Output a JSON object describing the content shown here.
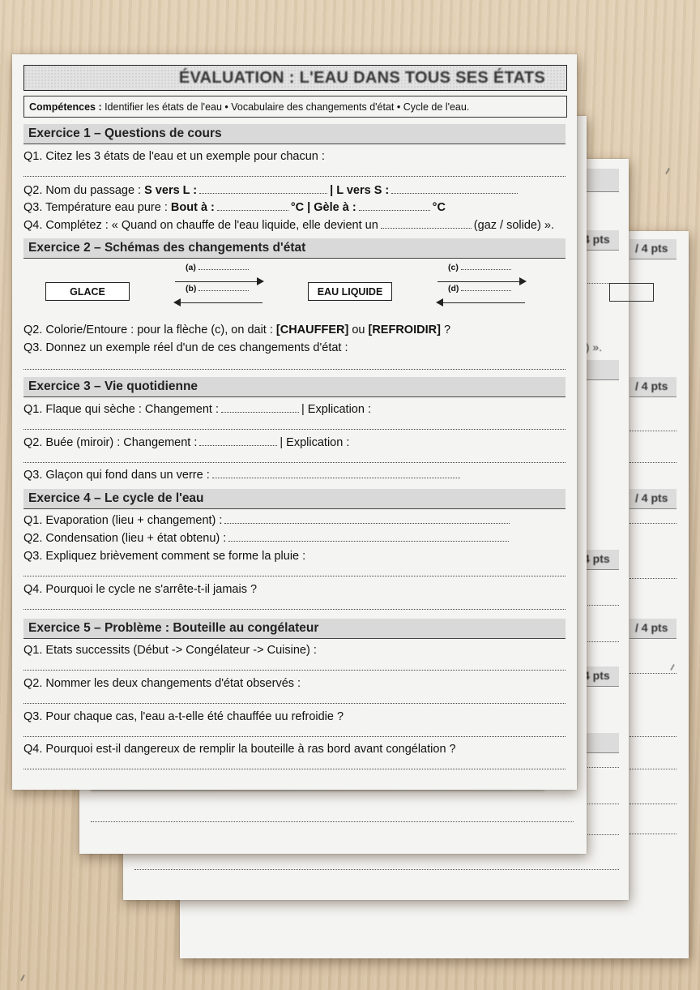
{
  "worksheet": {
    "title": "ÉVALUATION : L'EAU DANS TOUS SES ÉTATS",
    "competences_label": "Compétences :",
    "competences_text": " Identifier les états de l'eau • Vocabulaire des changements d'état • Cycle de l'eau.",
    "ex1": {
      "heading": "Exercice 1 – Questions de cours",
      "q1": "Q1. Citez les 3 états de l'eau et un exemple pour chacun :",
      "q2_a": "Q2. Nom du passage : ",
      "q2_b": "S vers L :",
      "q2_c": "| L vers S :",
      "q3_a": "Q3. Température eau pure : ",
      "q3_b": "Bout à :",
      "q3_c": "°C | Gèle à :",
      "q3_d": "°C",
      "q4_a": "Q4. Complétez : « Quand on chauffe de l'eau liquide, elle devient un",
      "q4_b": "(gaz / solide) »."
    },
    "ex2": {
      "heading": "Exercice 2 – Schémas des changements d'état",
      "box_glace": "GLACE",
      "box_eau": "EAU LIQUIDE",
      "label_a": "(a)",
      "label_b": "(b)",
      "label_c": "(c)",
      "label_d": "(d)",
      "q2_a": "Q2. Colorie/Entoure : pour la flèche (c), on dait : ",
      "q2_b": "[CHAUFFER]",
      "q2_c": " ou ",
      "q2_d": "[REFROIDIR]",
      "q2_e": " ?",
      "q3": "Q3. Donnez un exemple réel d'un de ces changements d'état :"
    },
    "ex3": {
      "heading": "Exercice 3 – Vie quotidienne",
      "q1_a": "Q1. Flaque qui sèche : Changement :",
      "q1_b": "| Explication :",
      "q2_a": "Q2. Buée (miroir) : Changement :",
      "q2_b": "| Explication :",
      "q3": "Q3. Glaçon qui fond dans un verre :"
    },
    "ex4": {
      "heading": "Exercice 4 – Le cycle de l'eau",
      "q1": "Q1. Evaporation (lieu + changement) :",
      "q2": "Q2. Condensation (lieu + état obtenu) :",
      "q3": "Q3. Expliquez brièvement comment se forme la pluie :",
      "q4": "Q4. Pourquoi le cycle ne s'arrête-t-il jamais ?"
    },
    "ex5": {
      "heading": "Exercice 5 – Problème : Bouteille au congélateur",
      "q1": "Q1. Etats successits (Début -> Congélateur -> Cuisine) :",
      "q2": "Q2. Nommer les deux changements d'état observés :",
      "q3": "Q3. Pour chaque cas, l'eau a-t-elle été chauffée uu refroidie ?",
      "q4": "Q4. Pourquoi est-il dangereux de remplir la bouteille à ras bord avant congélation ?"
    }
  },
  "behind_sheets": {
    "points_a": "4 pts",
    "points_b": "/ 4 pts",
    "points_c": "/ 4 pts",
    "points_d": "/ 4 pts",
    "points_e": "/ 4 pts",
    "points_f": "/ 4 pts",
    "points_g": "4 pts",
    "points_h": "4 pts",
    "fragment_e": "e) »."
  },
  "colors": {
    "table": "#dcc7a9",
    "paper": "#f4f4f2",
    "heading_bar": "#d9d9d9"
  }
}
